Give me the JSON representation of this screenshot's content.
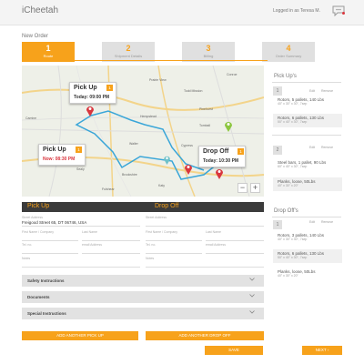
{
  "header": {
    "app_title": "iCheetah",
    "user_text": "Logged in as Teresa M.",
    "chat_icon": "chat-bubble-icon"
  },
  "page": {
    "title": "New Order"
  },
  "steps": [
    {
      "num": "1",
      "label": "Route"
    },
    {
      "num": "2",
      "label": "Shipment Details"
    },
    {
      "num": "3",
      "label": "Billing"
    },
    {
      "num": "4",
      "label": "Order Summary"
    }
  ],
  "map": {
    "labels": [
      "Todd Mission",
      "Hempstead",
      "Brookshire",
      "Katy",
      "Cypress",
      "Conroe",
      "Waller",
      "Sealy",
      "Fulshear",
      "Prairie View",
      "Pinehurst",
      "Tomball",
      "Camine"
    ],
    "pickup_callout": {
      "title": "Pick Up",
      "badge": "1",
      "time": "Today: 09:00 PM"
    },
    "pickup_callout_2": {
      "title": "Pick Up",
      "badge": "1",
      "time": "Now: 08:30 PM"
    },
    "dropoff_callout": {
      "title": "Drop Off",
      "badge": "1",
      "time": "Today: 10:30 PM"
    },
    "zoom_out": "−",
    "zoom_in": "+"
  },
  "form": {
    "pickup_header": "Pick Up",
    "dropoff_header": "Drop Off",
    "street_placeholder": "Street Address",
    "street_value": "Freigood Street 65, DT 06746, USA",
    "first_name_placeholder": "First Name / Company",
    "last_name_placeholder": "Last Name",
    "tel_placeholder": "Tel. no.",
    "email_placeholder": "email Address",
    "notes_placeholder": "Notes"
  },
  "accordions": [
    {
      "label": "Safety Instructions"
    },
    {
      "label": "Documents"
    },
    {
      "label": "Special Instructions"
    }
  ],
  "buttons": {
    "add_pickup": "ADD ANOTHER PICK UP",
    "add_dropoff": "ADD ANOTHER DROP OFF",
    "save": "SAVE",
    "next": "NEXT"
  },
  "right_panel": {
    "pickups_title": "Pick Up's",
    "dropoffs_title": "Drop Off's",
    "edit": "Edit",
    "remove": "Remove",
    "pickup_groups": [
      {
        "num": "1",
        "items": [
          {
            "name": "Rotors, 5 pallets, 140 Lbs",
            "dims": "40\" x 30\" x 30\", 7sep"
          },
          {
            "name": "Rotors, 6 pallets, 130 Lbs",
            "dims": "50\" x 40\" x 30\", 7sep"
          }
        ]
      },
      {
        "num": "2",
        "items": [
          {
            "name": "Steel bars, 1 pallet, 90 Lbs",
            "dims": "60\" x 40\" x 30\", 7sep"
          },
          {
            "name": "Planks, loose, 50Lbs",
            "dims": "40\" x 30\" x 20\""
          }
        ]
      }
    ],
    "dropoff_groups": [
      {
        "num": "1",
        "items": [
          {
            "name": "Rotors, 3 pallets, 140 Lbs",
            "dims": "40\" x 30\" x 30\", 7sep"
          },
          {
            "name": "Rotors, 6 pallets, 130 Lbs",
            "dims": "50\" x 40\" x 30\", 7sep"
          },
          {
            "name": "Planks, loose, 50Lbs",
            "dims": "40\" x 30\" x 20\""
          }
        ]
      }
    ]
  },
  "colors": {
    "accent": "#f7a21b",
    "dark": "#3b3b3b",
    "marker": "#d9363e",
    "route": "#3aa6d8"
  }
}
